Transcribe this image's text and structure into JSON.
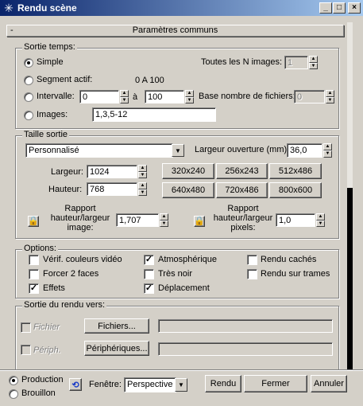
{
  "window": {
    "title": "Rendu scène",
    "app_icon": "asterisk-icon",
    "controls": {
      "minimize": "_",
      "maximize": "□",
      "close": "×"
    }
  },
  "rollout": {
    "collapse_symbol": "-",
    "title": "Paramètres communs"
  },
  "time_output": {
    "title": "Sortie temps:",
    "simple": "Simple",
    "every_n_label": "Toutes les N images:",
    "every_n_value": "1",
    "active_segment": "Segment actif:",
    "active_segment_range": "0 A 100",
    "range": "Intervalle:",
    "range_from": "0",
    "range_to_label": "à",
    "range_to": "100",
    "file_base_label": "Base nombre de fichiers:",
    "file_base_value": "0",
    "frames": "Images:",
    "frames_value": "1,3,5-12",
    "selected": "simple"
  },
  "output_size": {
    "title": "Taille sortie",
    "preset": "Personnalisé",
    "aperture_label": "Largeur ouverture (mm):",
    "aperture_value": "36,0",
    "width_label": "Largeur:",
    "width_value": "1024",
    "height_label": "Hauteur:",
    "height_value": "768",
    "presets": [
      "320x240",
      "256x243",
      "512x486",
      "640x480",
      "720x486",
      "800x600"
    ],
    "image_aspect_label": "Rapport hauteur/largeur image:",
    "image_aspect_value": "1,707",
    "pixel_aspect_label": "Rapport hauteur/largeur pixels:",
    "pixel_aspect_value": "1,0"
  },
  "options": {
    "title": "Options:",
    "items": [
      {
        "label": "Vérif. couleurs vidéo",
        "checked": false
      },
      {
        "label": "Atmosphérique",
        "checked": true
      },
      {
        "label": "Rendu cachés",
        "checked": false
      },
      {
        "label": "Forcer 2 faces",
        "checked": false
      },
      {
        "label": "Très noir",
        "checked": false
      },
      {
        "label": "Rendu sur trames",
        "checked": false
      },
      {
        "label": "Effets",
        "checked": true
      },
      {
        "label": "Déplacement",
        "checked": true
      }
    ],
    "check_mark": "✓"
  },
  "render_output": {
    "title": "Sortie du rendu vers:",
    "file_label": "Fichier",
    "files_button": "Fichiers...",
    "device_label": "Périph.",
    "devices_button": "Périphériques..."
  },
  "footer": {
    "production": "Production",
    "draft": "Brouillon",
    "selected": "production",
    "window_label": "Fenêtre:",
    "viewport": "Perspective",
    "render_button": "Rendu",
    "close_button": "Fermer",
    "cancel_button": "Annuler"
  }
}
